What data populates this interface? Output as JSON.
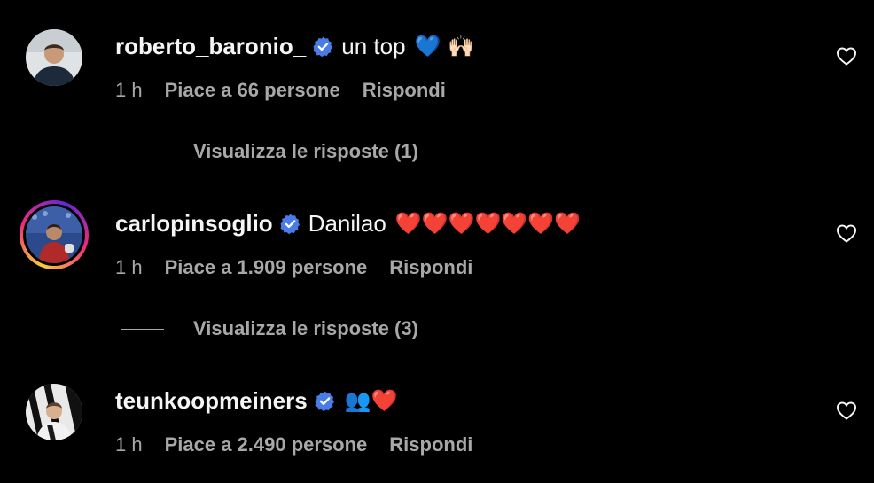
{
  "comments": [
    {
      "username": "roberto_baronio_",
      "text": "un top",
      "emojis": "💙 🙌🏻",
      "time": "1 h",
      "likes": "Piace a 66 persone",
      "reply": "Rispondi",
      "replies": "Visualizza le risposte (1)"
    },
    {
      "username": "carlopinsoglio",
      "text": "Danilao",
      "emojis": "❤️❤️❤️❤️❤️❤️❤️",
      "time": "1 h",
      "likes": "Piace a 1.909 persone",
      "reply": "Rispondi",
      "replies": "Visualizza le risposte (3)"
    },
    {
      "username": "teunkoopmeiners",
      "text": "",
      "emojis": "👥❤️",
      "time": "1 h",
      "likes": "Piace a 2.490 persone",
      "reply": "Rispondi"
    }
  ],
  "colors": {
    "background": "#000000",
    "primary_text": "#f5f5f5",
    "secondary_text": "#a8a8a8",
    "verified": "#4a7ce8",
    "heart": "#e0245e",
    "blue_heart": "#3e7bfa"
  },
  "icons": [
    "verified-badge-icon",
    "heart-outline-icon"
  ]
}
